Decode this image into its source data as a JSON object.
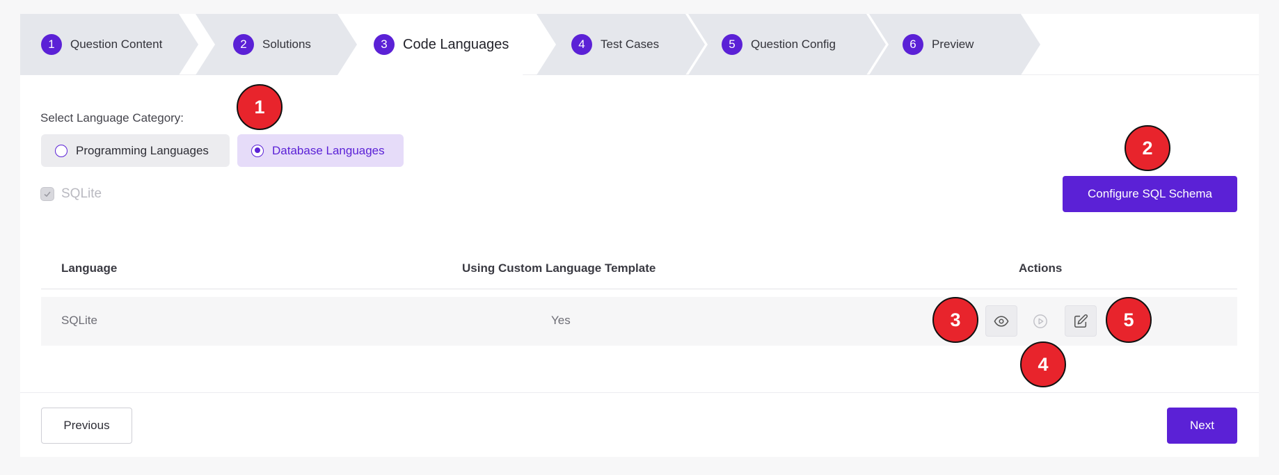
{
  "stepper": {
    "steps": [
      {
        "number": "1",
        "label": "Question Content"
      },
      {
        "number": "2",
        "label": "Solutions"
      },
      {
        "number": "3",
        "label": "Code Languages"
      },
      {
        "number": "4",
        "label": "Test Cases"
      },
      {
        "number": "5",
        "label": "Question Config"
      },
      {
        "number": "6",
        "label": "Preview"
      }
    ],
    "active_step": "3"
  },
  "category": {
    "label": "Select Language Category:",
    "options": [
      {
        "label": "Programming Languages",
        "selected": false
      },
      {
        "label": "Database Languages",
        "selected": true
      }
    ]
  },
  "languages": {
    "checkbox_label": "SQLite",
    "checked": true
  },
  "toolbar": {
    "configure_label": "Configure SQL Schema"
  },
  "table": {
    "headers": [
      "Language",
      "Using Custom Language Template",
      "Actions"
    ],
    "rows": [
      {
        "language": "SQLite",
        "custom_template": "Yes"
      }
    ]
  },
  "footer": {
    "previous_label": "Previous",
    "next_label": "Next"
  },
  "markers": [
    "1",
    "2",
    "3",
    "4",
    "5"
  ],
  "colors": {
    "accent": "#5b21d6",
    "marker": "#e8242c"
  }
}
